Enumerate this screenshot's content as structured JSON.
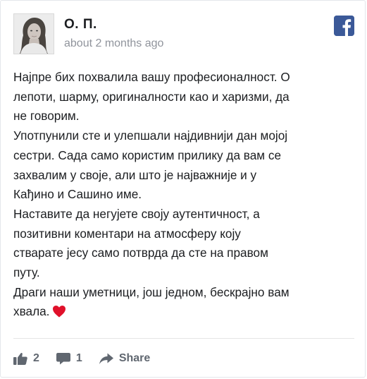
{
  "review": {
    "author_name": "О. П.",
    "time_ago": "about 2 months ago",
    "platform_icon": "facebook-icon",
    "brand_color": "#3b5998",
    "text_lines": [
      "Најпре бих похвалила вашу професионалност. О",
      "лепоти, шарму, оригиналности као и харизми, да",
      "не говорим.",
      "Употпунили сте и улепшали најдивнији дан мојој",
      "сестри. Сада само користим прилику да вам се",
      "захвалим у своје, али што је најважније и у",
      "Кађино и Сашино име.",
      "Наставите да негујете своју аутентичност, а",
      "позитивни коментари на атмосферу коју",
      "стварате јесу само потврда да сте на правом",
      "путу.",
      "Драги наши уметници, још једном, бескрајно вам",
      "хвала."
    ],
    "emoji": "red-heart",
    "heart_color": "#e0102a"
  },
  "actions": {
    "likes_count": "2",
    "comments_count": "1",
    "share_label": "Share",
    "icon_color": "#606770"
  }
}
